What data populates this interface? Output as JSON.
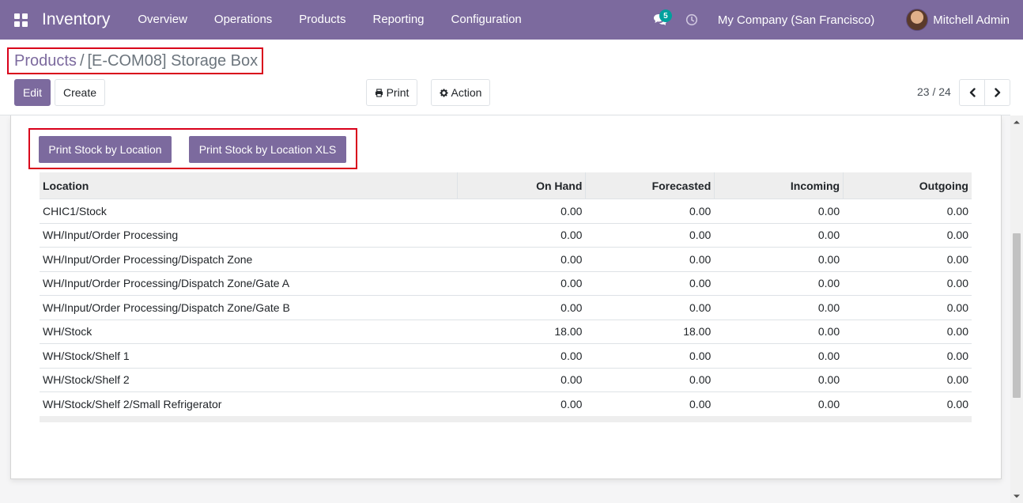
{
  "navbar": {
    "app_title": "Inventory",
    "menu": [
      "Overview",
      "Operations",
      "Products",
      "Reporting",
      "Configuration"
    ],
    "messages_count": "5",
    "company": "My Company (San Francisco)",
    "user": "Mitchell Admin",
    "icons": [
      "apps-icon",
      "chat-icon",
      "clock-icon"
    ]
  },
  "breadcrumb": {
    "parent": "Products",
    "separator": "/",
    "current": "[E-COM08] Storage Box"
  },
  "toolbar": {
    "edit_label": "Edit",
    "create_label": "Create",
    "print_label": "Print",
    "action_label": "Action"
  },
  "pager": {
    "value": "23 / 24"
  },
  "report_buttons": {
    "stock_by_location": "Print Stock by Location",
    "stock_by_location_xls": "Print Stock by Location XLS"
  },
  "table": {
    "columns": [
      "Location",
      "On Hand",
      "Forecasted",
      "Incoming",
      "Outgoing"
    ],
    "rows": [
      [
        "CHIC1/Stock",
        "0.00",
        "0.00",
        "0.00",
        "0.00"
      ],
      [
        "WH/Input/Order Processing",
        "0.00",
        "0.00",
        "0.00",
        "0.00"
      ],
      [
        "WH/Input/Order Processing/Dispatch Zone",
        "0.00",
        "0.00",
        "0.00",
        "0.00"
      ],
      [
        "WH/Input/Order Processing/Dispatch Zone/Gate A",
        "0.00",
        "0.00",
        "0.00",
        "0.00"
      ],
      [
        "WH/Input/Order Processing/Dispatch Zone/Gate B",
        "0.00",
        "0.00",
        "0.00",
        "0.00"
      ],
      [
        "WH/Stock",
        "18.00",
        "18.00",
        "0.00",
        "0.00"
      ],
      [
        "WH/Stock/Shelf 1",
        "0.00",
        "0.00",
        "0.00",
        "0.00"
      ],
      [
        "WH/Stock/Shelf 2",
        "0.00",
        "0.00",
        "0.00",
        "0.00"
      ],
      [
        "WH/Stock/Shelf 2/Small Refrigerator",
        "0.00",
        "0.00",
        "0.00",
        "0.00"
      ]
    ]
  },
  "colors": {
    "brand": "#7c6a9e",
    "badge": "#00a09d",
    "highlight_border": "#d9001b"
  }
}
